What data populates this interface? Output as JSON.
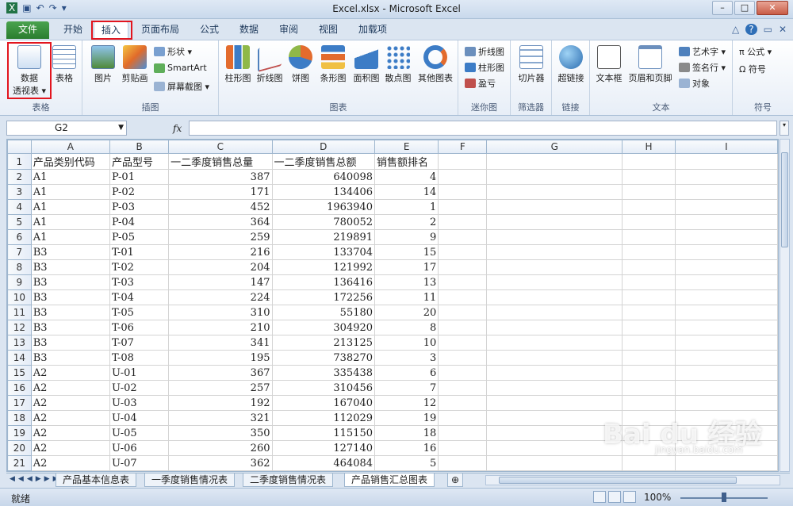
{
  "window": {
    "title": "Excel.xlsx - Microsoft Excel"
  },
  "tabs": [
    "文件",
    "开始",
    "插入",
    "页面布局",
    "公式",
    "数据",
    "审阅",
    "视图",
    "加载项"
  ],
  "ribbon": {
    "groups": {
      "tables": "表格",
      "illustrations": "插图",
      "charts": "图表",
      "sparklines": "迷你图",
      "filter": "筛选器",
      "links": "链接",
      "text": "文本",
      "symbols": "符号"
    },
    "pivot": "数据\n透视表 ▾",
    "pivot_line1": "数据",
    "pivot_line2": "透视表 ▾",
    "table": "表格",
    "picture": "图片",
    "clipart": "剪贴画",
    "shapes": "形状 ▾",
    "smartart": "SmartArt",
    "screenshot": "屏幕截图 ▾",
    "bar": "柱形图",
    "line": "折线图",
    "pie": "饼图",
    "hbar": "条形图",
    "area": "面积图",
    "scatter": "散点图",
    "other": "其他图表",
    "spark_line": "折线图",
    "spark_col": "柱形图",
    "spark_wl": "盈亏",
    "slicer": "切片器",
    "hyperlink": "超链接",
    "textbox": "文本框",
    "headerfooter": "页眉和页脚",
    "wordart": "艺术字 ▾",
    "signature": "签名行 ▾",
    "object": "对象",
    "equation": "π 公式 ▾",
    "symbol": "Ω 符号"
  },
  "formula_bar": {
    "name_box": "G2",
    "fx": "fx",
    "value": ""
  },
  "columns": [
    "A",
    "B",
    "C",
    "D",
    "E",
    "F",
    "G",
    "H",
    "I"
  ],
  "header_row": [
    "产品类别代码",
    "产品型号",
    "一二季度销售总量",
    "一二季度销售总额",
    "销售额排名"
  ],
  "rows": [
    [
      "A1",
      "P-01",
      "387",
      "640098",
      "4"
    ],
    [
      "A1",
      "P-02",
      "171",
      "134406",
      "14"
    ],
    [
      "A1",
      "P-03",
      "452",
      "1963940",
      "1"
    ],
    [
      "A1",
      "P-04",
      "364",
      "780052",
      "2"
    ],
    [
      "A1",
      "P-05",
      "259",
      "219891",
      "9"
    ],
    [
      "B3",
      "T-01",
      "216",
      "133704",
      "15"
    ],
    [
      "B3",
      "T-02",
      "204",
      "121992",
      "17"
    ],
    [
      "B3",
      "T-03",
      "147",
      "136416",
      "13"
    ],
    [
      "B3",
      "T-04",
      "224",
      "172256",
      "11"
    ],
    [
      "B3",
      "T-05",
      "310",
      "55180",
      "20"
    ],
    [
      "B3",
      "T-06",
      "210",
      "304920",
      "8"
    ],
    [
      "B3",
      "T-07",
      "341",
      "213125",
      "10"
    ],
    [
      "B3",
      "T-08",
      "195",
      "738270",
      "3"
    ],
    [
      "A2",
      "U-01",
      "367",
      "335438",
      "6"
    ],
    [
      "A2",
      "U-02",
      "257",
      "310456",
      "7"
    ],
    [
      "A2",
      "U-03",
      "192",
      "167040",
      "12"
    ],
    [
      "A2",
      "U-04",
      "321",
      "112029",
      "19"
    ],
    [
      "A2",
      "U-05",
      "350",
      "115150",
      "18"
    ],
    [
      "A2",
      "U-06",
      "260",
      "127140",
      "16"
    ],
    [
      "A2",
      "U-07",
      "362",
      "464084",
      "5"
    ]
  ],
  "row_numbers": [
    "1",
    "2",
    "3",
    "4",
    "5",
    "6",
    "7",
    "8",
    "9",
    "10",
    "11",
    "12",
    "13",
    "14",
    "15",
    "16",
    "17",
    "18",
    "19",
    "20",
    "21",
    "22"
  ],
  "sheets": [
    "产品基本信息表",
    "一季度销售情况表",
    "二季度销售情况表",
    "产品销售汇总图表"
  ],
  "status": {
    "ready": "就绪",
    "zoom": "100%"
  },
  "watermark": {
    "logo": "Bai du 经验",
    "url": "jingyan.baidu.com"
  },
  "colors": {
    "file_tab": "#2a7d2f",
    "highlight": "#e2151e"
  }
}
